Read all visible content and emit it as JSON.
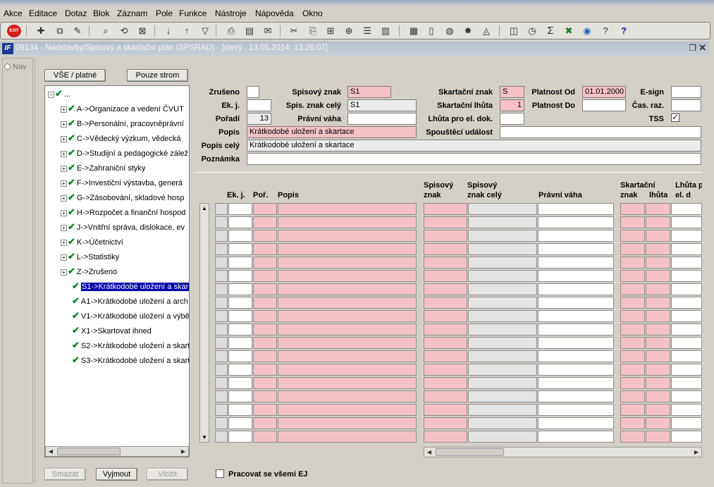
{
  "menu": [
    "Akce",
    "Editace",
    "Dotaz",
    "Blok",
    "Záznam",
    "Pole",
    "Funkce",
    "Nástroje",
    "Nápověda",
    "Okno"
  ],
  "toolbar": {
    "exit_label": "EXIT"
  },
  "window": {
    "title": "09134 - Nadstavby/Spisový a skartační plán (SPSRAD) - [úterý  , 13.05.2014; 13:26:07]",
    "app_icon": "IF"
  },
  "left_strip": {
    "nav_label": "Nav"
  },
  "buttons": {
    "all_valid": "VŠE / platné",
    "tree_only": "Pouze strom",
    "delete": "Smazat",
    "cut": "Vyjmout",
    "paste": "Vložit"
  },
  "tree": {
    "root_label": "...",
    "items": [
      "A->Organizace a vedení ČVUT",
      "B->Personální, pracovněprávní",
      "C->Vědecký výzkum, vědecká",
      "D->Studijní a pedagogické zálež",
      "E->Zahraniční styky",
      "F->Investiční výstavba, generá",
      "G->Zásobování, skladové hosp",
      "H->Rozpočet a finanční hospod",
      "J->Vnitřní správa, dislokace, ev",
      "K->Účetnictví",
      "L->Statistiky",
      "Z->Zrušeno"
    ],
    "children": [
      "S1->Krátkodobé uložení a skar",
      "A1->Krátkodobé uložení a arch",
      "V1->Krátkodobé uložení a výbě",
      "X1->Skartovat ihned",
      "S2->Krátkodobé uložení a skart",
      "S3->Krátkodobé uložení a skart"
    ]
  },
  "form": {
    "zruseno_label": "Zrušeno",
    "ekj_label": "Ek. j.",
    "poradi_label": "Pořadí",
    "poradi_value": "13",
    "popis_label": "Popis",
    "popis_value": "Krátkodobé uložení a skartace",
    "popis_cely_label": "Popis celý",
    "popis_cely_value": "Krátkodobé uložení a skartace",
    "poznamka_label": "Poznámka",
    "spisovy_znak_label": "Spisový znak",
    "spisovy_znak_value": "S1",
    "spis_znak_cely_label": "Spis. znak celý",
    "spis_znak_cely_value": "S1",
    "pravni_vaha_label": "Právní váha",
    "skartacni_znak_label": "Skartační znak",
    "skartacni_znak_value": "S",
    "skartacni_lhuta_label": "Skartační lhůta",
    "skartacni_lhuta_value": "1",
    "lhuta_el_label": "Lhůta pro el. dok.",
    "spousteci_label": "Spouštěcí událost",
    "platnost_od_label": "Platnost Od",
    "platnost_od_value": "01.01.2000",
    "platnost_do_label": "Platnost Do",
    "esign_label": "E-sign",
    "cas_raz_label": "Čas. raz.",
    "tss_label": "TSS",
    "tss_checked": "✓"
  },
  "grid": {
    "headers": {
      "ekj": "Ek. j.",
      "por": "Poř.",
      "popis": "Popis",
      "spisovy_znak": "Spisový\nznak",
      "spisovy_znak_cely": "Spisový\nznak celý",
      "pravni_vaha": "Právní váha",
      "skartacni": "Skartační\nznak",
      "lhuta": "lhůta",
      "lhuta_el": "Lhůta p\nel. d"
    },
    "row_count": 18
  },
  "footer": {
    "all_ej_label": "Pracovat se všemi EJ"
  },
  "colors": {
    "required": "#f4c2c6",
    "readonly": "#e4e4e4",
    "selected": "#0000a8",
    "check": "#11842a"
  }
}
